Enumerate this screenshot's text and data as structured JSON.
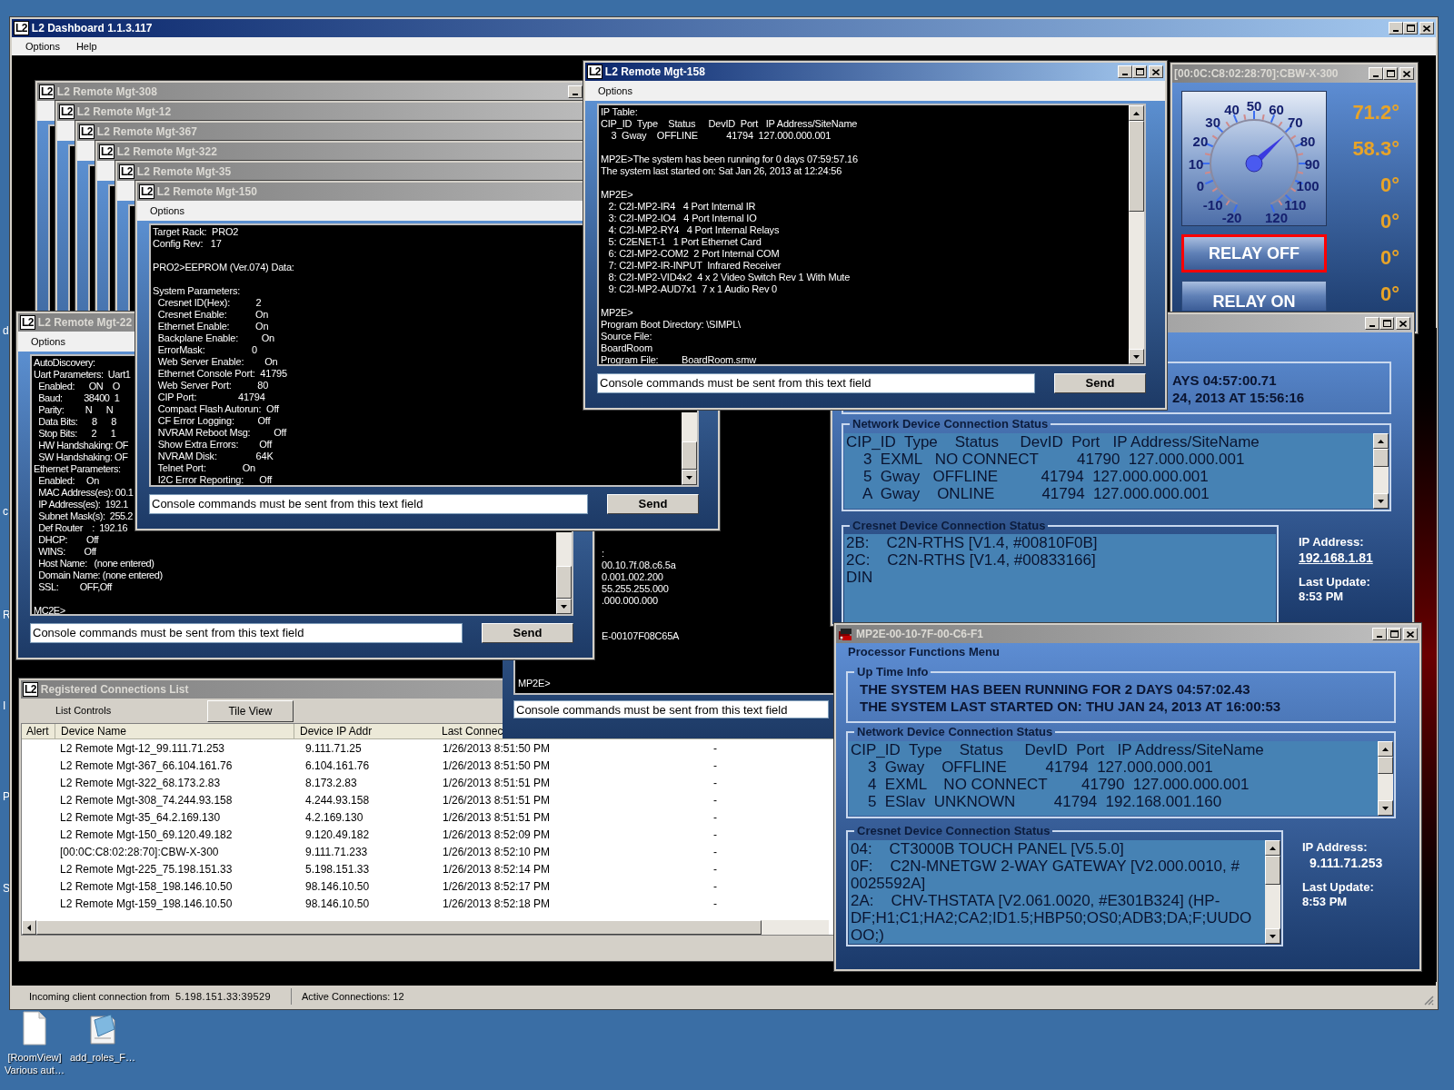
{
  "main_window": {
    "logo": "L2",
    "title": "L2 Dashboard 1.1.3.117",
    "active": true,
    "menu": [
      "Options",
      "Help"
    ]
  },
  "cascade_windows": [
    {
      "logo": "L2",
      "title": "L2 Remote Mgt-308",
      "active": false
    },
    {
      "logo": "L2",
      "title": "L2 Remote Mgt-12",
      "active": false
    },
    {
      "logo": "L2",
      "title": "L2 Remote Mgt-367",
      "active": false
    },
    {
      "logo": "L2",
      "title": "L2 Remote Mgt-322",
      "active": false
    },
    {
      "logo": "L2",
      "title": "L2 Remote Mgt-35",
      "active": false
    }
  ],
  "cbw_window": {
    "title": "[00:0C:C8:02:28:70]:CBW-X-300",
    "active": false,
    "gauge": {
      "labels": [
        "50",
        "40",
        "60",
        "30",
        "70",
        "20",
        "80",
        "10",
        "90",
        "0",
        "100",
        "-10",
        "110",
        "-20",
        "120"
      ],
      "level": 0.65
    },
    "relays": [
      {
        "label": "RELAY OFF",
        "selected": true
      },
      {
        "label": "RELAY ON",
        "selected": false
      }
    ],
    "temperatures": [
      "71.2°",
      "58.3°",
      "0°",
      "0°",
      "0°",
      "0°"
    ]
  },
  "registered_list": {
    "logo": "L2",
    "title": "Registered Connections List",
    "active": false,
    "toolbar_label": "List Controls",
    "tile_button": "Tile View",
    "columns": [
      "Alert",
      "Device Name",
      "Device IP Addr",
      "Last Connec"
    ],
    "rows": [
      {
        "device_name": "L2 Remote Mgt-12_99.111.71.253",
        "ip": "9.111.71.25",
        "last_connect": "1/26/2013 8:51:50 PM",
        "column_5": "-"
      },
      {
        "device_name": "L2 Remote Mgt-367_66.104.161.76",
        "ip": "6.104.161.76",
        "last_connect": "1/26/2013 8:51:50 PM",
        "column_5": "-"
      },
      {
        "device_name": "L2 Remote Mgt-322_68.173.2.83",
        "ip": "8.173.2.83",
        "last_connect": "1/26/2013 8:51:51 PM",
        "column_5": "-"
      },
      {
        "device_name": "L2 Remote Mgt-308_74.244.93.158",
        "ip": "4.244.93.158",
        "last_connect": "1/26/2013 8:51:51 PM",
        "column_5": "-"
      },
      {
        "device_name": "L2 Remote Mgt-35_64.2.169.130",
        "ip": "4.2.169.130",
        "last_connect": "1/26/2013 8:51:51 PM",
        "column_5": "-"
      },
      {
        "device_name": "L2 Remote Mgt-150_69.120.49.182",
        "ip": "9.120.49.182",
        "last_connect": "1/26/2013 8:52:09 PM",
        "column_5": "-"
      },
      {
        "device_name": "[00:0C:C8:02:28:70]:CBW-X-300",
        "ip": "9.111.71.233",
        "last_connect": "1/26/2013 8:52:10 PM",
        "column_5": "-"
      },
      {
        "device_name": "L2 Remote Mgt-225_75.198.151.33",
        "ip": "5.198.151.33",
        "last_connect": "1/26/2013 8:52:14 PM",
        "column_5": "-"
      },
      {
        "device_name": "L2 Remote Mgt-158_198.146.10.50",
        "ip": "98.146.10.50",
        "last_connect": "1/26/2013 8:52:17 PM",
        "column_5": "-"
      },
      {
        "device_name": "L2 Remote Mgt-159_198.146.10.50",
        "ip": "98.146.10.50",
        "last_connect": "1/26/2013 8:52:18 PM",
        "column_5": "-"
      }
    ]
  },
  "middle_console": {
    "console": [
      [
        ":",
        "00.10.7f.08.c6.5a",
        "0.001.002.200",
        "55.255.255.000",
        ".000.000.000"
      ],
      [
        "E-00107F08C65A"
      ],
      [
        "MP2E>"
      ]
    ],
    "command_field": {
      "value": "Console commands must be sent from this text field"
    }
  },
  "unit_window": {
    "active": false,
    "uptime": [
      "AYS 04:57:00.71",
      "24, 2013 AT 15:56:16"
    ],
    "network": {
      "legend": "Network Device Connection Status",
      "header": "CIP_ID  Type    Status     DevID  Port   IP Address/SiteName",
      "rows": [
        "    3  EXML   NO CONNECT         41790  127.000.000.001",
        "    5  Gway   OFFLINE          41794  127.000.000.001",
        "    A  Gway    ONLINE           41794  127.000.000.001"
      ]
    },
    "cresnet": {
      "legend": "Cresnet Device Connection Status",
      "lines": [
        "2B:    C2N-RTHS [V1.4, #00810F0B]",
        "2C:    C2N-RTHS [V1.4, #00833166]",
        "DIN"
      ]
    },
    "ip_label": "IP Address:",
    "ip": "192.168.1.81",
    "ip_underlined": true,
    "update_label": "Last Update:",
    "update": "8:53 PM"
  },
  "mgt225": {
    "logo": "L2",
    "title": "L2 Remote Mgt-22",
    "active": false,
    "menu": "Options",
    "console": [
      [
        "AutoDiscovery:",
        "Uart Parameters:  Uart1",
        "  Enabled:      ON    O",
        "  Baud:         38400  1",
        "  Parity:         N      N",
        "  Data Bits:      8      8",
        "  Stop Bits:      2      1",
        "  HW Handshaking: OF",
        "  SW Handshaking: OF",
        "Ethernet Parameters:",
        "  Enabled:     On",
        "  MAC Address(es): 00.1",
        "  IP Address(es):  192.1",
        "  Subnet Mask(s):  255.2",
        "  Def Router    :  192.16",
        "  DHCP:        Off",
        "  WINS:        Off",
        "  Host Name:   (none entered)",
        "  Domain Name: (none entered)",
        "  SSL:         OFF,Off"
      ],
      [
        "MC2E>"
      ]
    ],
    "command_field": {
      "value": "Console commands must be sent from this text field"
    },
    "send": "Send"
  },
  "mgt150": {
    "logo": "L2",
    "title": "L2 Remote Mgt-150",
    "active": false,
    "menu": "Options",
    "console": [
      [
        "Target Rack:  PRO2",
        "Config Rev:   17"
      ],
      [
        "PRO2>EEPROM (Ver.074) Data:"
      ],
      [
        "System Parameters:",
        "  Cresnet ID(Hex):          2",
        "  Cresnet Enable:           On",
        "  Ethernet Enable:          On",
        "  Backplane Enable:         On",
        "  ErrorMask:                  0",
        "  Web Server Enable:        On",
        "  Ethernet Console Port:  41795",
        "  Web Server Port:          80",
        "  CIP Port:                41794",
        "  Compact Flash Autorun:  Off",
        "  CF Error Logging:         Off",
        "  NVRAM Reboot Msg:         Off",
        "  Show Extra Errors:        Off",
        "  NVRAM Disk:               64K",
        "  Telnet Port:              On",
        "  I2C Error Reporting:      Off"
      ]
    ],
    "command_field": {
      "value": "Console commands must be sent from this text field"
    },
    "send": "Send"
  },
  "mgt158": {
    "logo": "L2",
    "title": "L2 Remote Mgt-158",
    "active": true,
    "menu": "Options",
    "console": [
      [
        "IP Table:",
        "CIP_ID  Type    Status     DevID  Port   IP Address/SiteName",
        "    3  Gway    OFFLINE           41794  127.000.000.001"
      ],
      [
        "MP2E>The system has been running for 0 days 07:59:57.16",
        "The system last started on: Sat Jan 26, 2013 at 12:24:56"
      ],
      [
        "MP2E>",
        "   2: C2I-MP2-IR4   4 Port Internal IR",
        "   3: C2I-MP2-IO4   4 Port Internal IO",
        "   4: C2I-MP2-RY4   4 Port Internal Relays",
        "   5: C2ENET-1   1 Port Ethernet Card",
        "   6: C2I-MP2-COM2  2 Port Internal COM",
        "   7: C2I-MP2-IR-INPUT  Infrared Receiver",
        "   8: C2I-MP2-VID4x2  4 x 2 Video Switch Rev 1 With Mute",
        "   9: C2I-MP2-AUD7x1  7 x 1 Audio Rev 0"
      ],
      [
        "MP2E>",
        "Program Boot Directory: \\SIMPL\\",
        "Source File:",
        "BoardRoom",
        "Program File:         BoardRoom.smw"
      ]
    ],
    "command_field": {
      "value": "Console commands must be sent from this text field"
    },
    "send": "Send"
  },
  "mp2e_window": {
    "title": "MP2E-00-10-7F-00-C6-F1",
    "active": false,
    "menu_title": "Processor Functions Menu",
    "uptime": {
      "legend": "Up Time Info",
      "lines": [
        "THE SYSTEM HAS BEEN RUNNING FOR 2 DAYS 04:57:02.43",
        "THE SYSTEM LAST STARTED ON: THU JAN 24, 2013 AT 16:00:53"
      ]
    },
    "network": {
      "legend": "Network Device Connection Status",
      "header": "CIP_ID  Type    Status     DevID  Port   IP Address/SiteName",
      "rows": [
        "    3  Gway    OFFLINE         41794  127.000.000.001",
        "    4  EXML    NO CONNECT        41790  127.000.000.001",
        "    5  ESlav  UNKNOWN         41794  192.168.001.160"
      ]
    },
    "cresnet": {
      "legend": "Cresnet Device Connection Status",
      "lines": [
        "04:    CT3000B TOUCH PANEL [V5.5.0]",
        "0F:    C2N-MNETGW 2-WAY GATEWAY [V2.000.0010, #",
        "0025592A]",
        "2A:    CHV-THSTATA [V2.061.0020, #E301B324] (HP-",
        "DF;H1;C1;HA2;CA2;ID1.5;HBP50;OS0;ADB3;DA;F;UUDO",
        "OO;)"
      ]
    },
    "ip_label": "IP Address:",
    "ip": "9.111.71.253",
    "ip_underlined": false,
    "update_label": "Last Update:",
    "update": "8:53 PM"
  },
  "status_bar": {
    "connection_label": "Incoming client connection from",
    "connection_address": "5.198.151.33:39529",
    "active_connections": "Active Connections: 12"
  },
  "desktop_edge_letters": [
    "d",
    "c",
    "R",
    "I",
    "P",
    "S"
  ],
  "desktop_icons": [
    {
      "kind": "document",
      "label_lines": [
        "[RoomView]",
        "Various aut…"
      ]
    },
    {
      "kind": "notepad",
      "label_lines": [
        "add_roles_F…"
      ]
    }
  ]
}
